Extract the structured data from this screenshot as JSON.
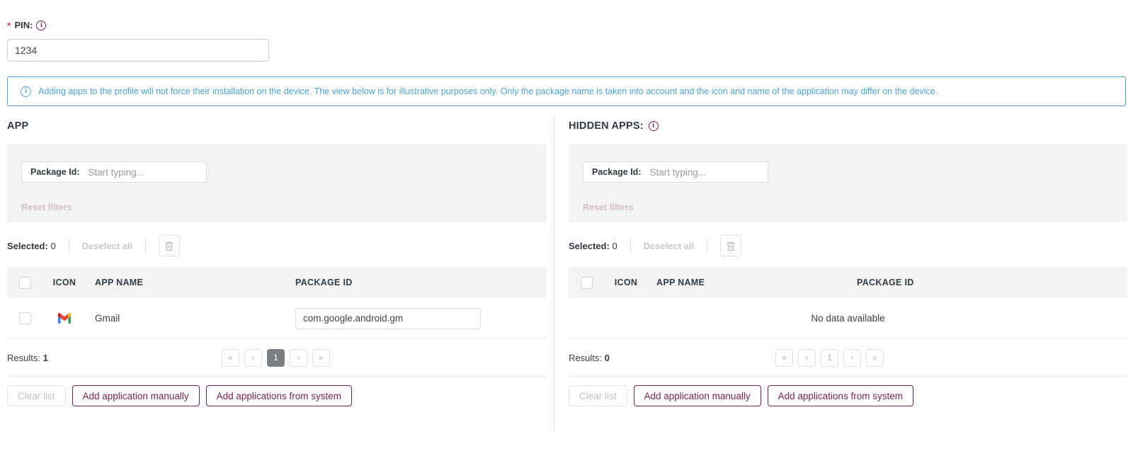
{
  "pin": {
    "label": "PIN:",
    "required_marker": "*",
    "value": "1234",
    "info_icon": "info-circle-icon"
  },
  "banner": {
    "icon": "info-circle-icon",
    "text": "Adding apps to the profile will not force their installation on the device. The view below is for illustrative purposes only. Only the package name is taken into account and the icon and name of the application may differ on the device.",
    "color": "#4aa3df"
  },
  "colors": {
    "accent": "#7a1f4f",
    "info_blue": "#4aa3df",
    "required_red": "#d9534f",
    "panel_gray": "#f3f3f3",
    "active_page": "#7b7f83"
  },
  "panels": [
    {
      "title": "APP",
      "has_info_icon": false,
      "filter": {
        "label": "Package Id:",
        "value": "",
        "placeholder": "Start typing...",
        "reset_label": "Reset filters"
      },
      "selection": {
        "selected_label": "Selected:",
        "selected_count": "0",
        "deselect_label": "Deselect all",
        "delete_icon": "trash-icon"
      },
      "table": {
        "columns": [
          "ICON",
          "APP NAME",
          "PACKAGE ID"
        ],
        "rows": [
          {
            "icon": "gmail-icon",
            "app_name": "Gmail",
            "package_id": "com.google.android.gm"
          }
        ],
        "empty_text": ""
      },
      "pagination": {
        "results_label": "Results:",
        "results_count": "1",
        "first": "«",
        "prev": "‹",
        "page": "1",
        "next": "›",
        "last": "»",
        "page_active": true
      },
      "footer": {
        "clear_label": "Clear list",
        "clear_disabled": true,
        "add_manual_label": "Add application manually",
        "add_system_label": "Add applications from system"
      }
    },
    {
      "title": "HIDDEN APPS:",
      "has_info_icon": true,
      "info_icon": "info-circle-icon",
      "filter": {
        "label": "Package Id:",
        "value": "",
        "placeholder": "Start typing...",
        "reset_label": "Reset filters"
      },
      "selection": {
        "selected_label": "Selected:",
        "selected_count": "0",
        "deselect_label": "Deselect all",
        "delete_icon": "trash-icon"
      },
      "table": {
        "columns": [
          "ICON",
          "APP NAME",
          "PACKAGE ID"
        ],
        "rows": [],
        "empty_text": "No data available"
      },
      "pagination": {
        "results_label": "Results:",
        "results_count": "0",
        "first": "«",
        "prev": "‹",
        "page": "1",
        "next": "›",
        "last": "»",
        "page_active": false
      },
      "footer": {
        "clear_label": "Clear list",
        "clear_disabled": true,
        "add_manual_label": "Add application manually",
        "add_system_label": "Add applications from system"
      }
    }
  ]
}
